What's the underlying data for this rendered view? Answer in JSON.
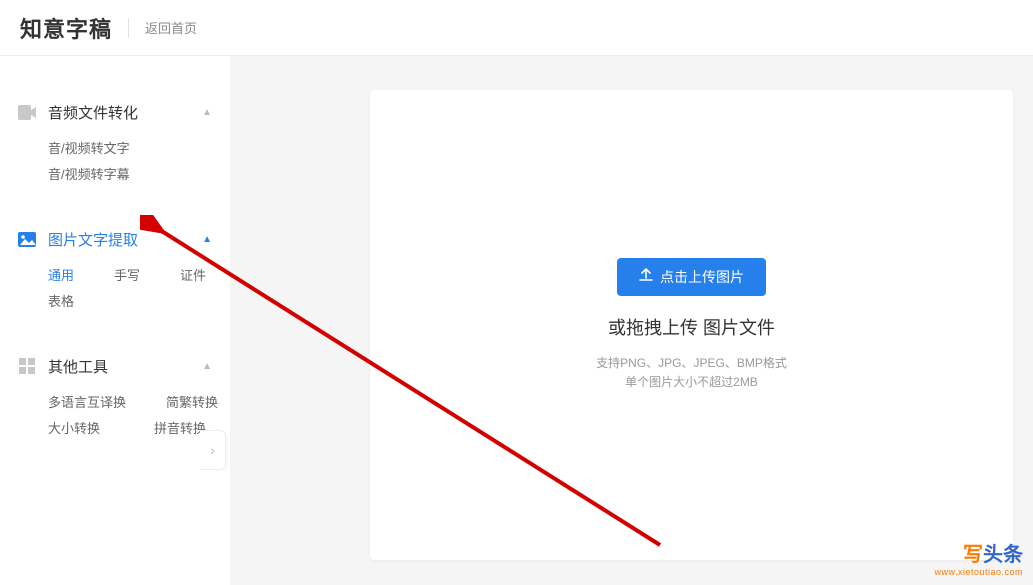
{
  "header": {
    "logo": "知意字稿",
    "home_link": "返回首页"
  },
  "sidebar": {
    "sections": [
      {
        "title": "音频文件转化",
        "items": [
          {
            "row": [
              "音/视频转文字"
            ]
          },
          {
            "row": [
              "音/视频转字幕"
            ]
          }
        ]
      },
      {
        "title": "图片文字提取",
        "active": true,
        "items": [
          {
            "row": [
              "通用",
              "手写",
              "证件"
            ],
            "active_index": 0
          },
          {
            "row": [
              "表格"
            ]
          }
        ]
      },
      {
        "title": "其他工具",
        "items": [
          {
            "row": [
              "多语言互译换",
              "简繁转换"
            ]
          },
          {
            "row": [
              "大小转换",
              "拼音转换"
            ]
          }
        ]
      }
    ]
  },
  "main": {
    "upload_button": "点击上传图片",
    "drag_title": "或拖拽上传 图片文件",
    "hint_line1": "支持PNG、JPG、JPEG、BMP格式",
    "hint_line2": "单个图片大小不超过2MB"
  },
  "watermark": {
    "char1": "写",
    "chars_rest": "头条",
    "url": "www.xietoutiao.com"
  }
}
